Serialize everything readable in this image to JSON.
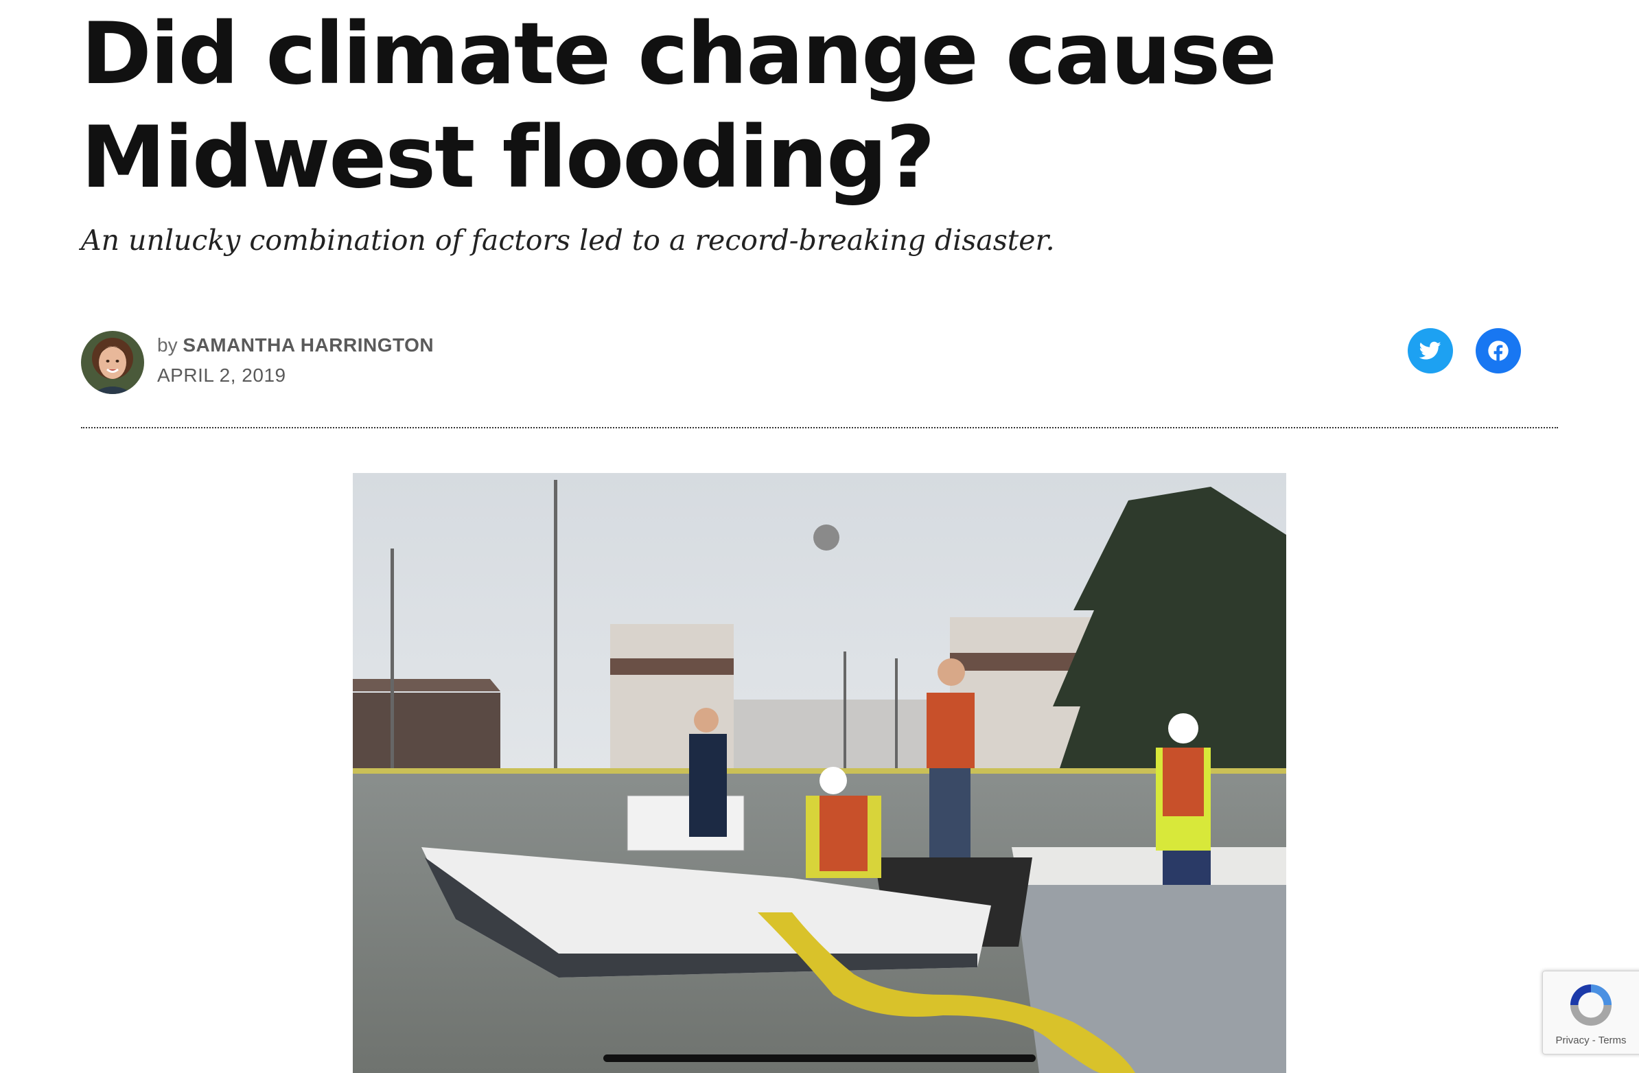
{
  "article": {
    "title": "Did climate change cause Midwest flooding?",
    "dek": "An unlucky combination of factors led to a record-breaking disaster.",
    "byline_prefix": "by",
    "author": "SAMANTHA HARRINGTON",
    "date": "APRIL 2, 2019"
  },
  "share": {
    "twitter_icon": "twitter-icon",
    "facebook_icon": "facebook-icon"
  },
  "hero_image": {
    "alt": "Workers in a boat laying a yellow flood boom along a sandbag levee in floodwaters"
  },
  "recaptcha": {
    "privacy": "Privacy",
    "separator": "-",
    "terms": "Terms"
  },
  "colors": {
    "twitter": "#1da1f2",
    "facebook": "#1877f2",
    "headline": "#111111"
  }
}
